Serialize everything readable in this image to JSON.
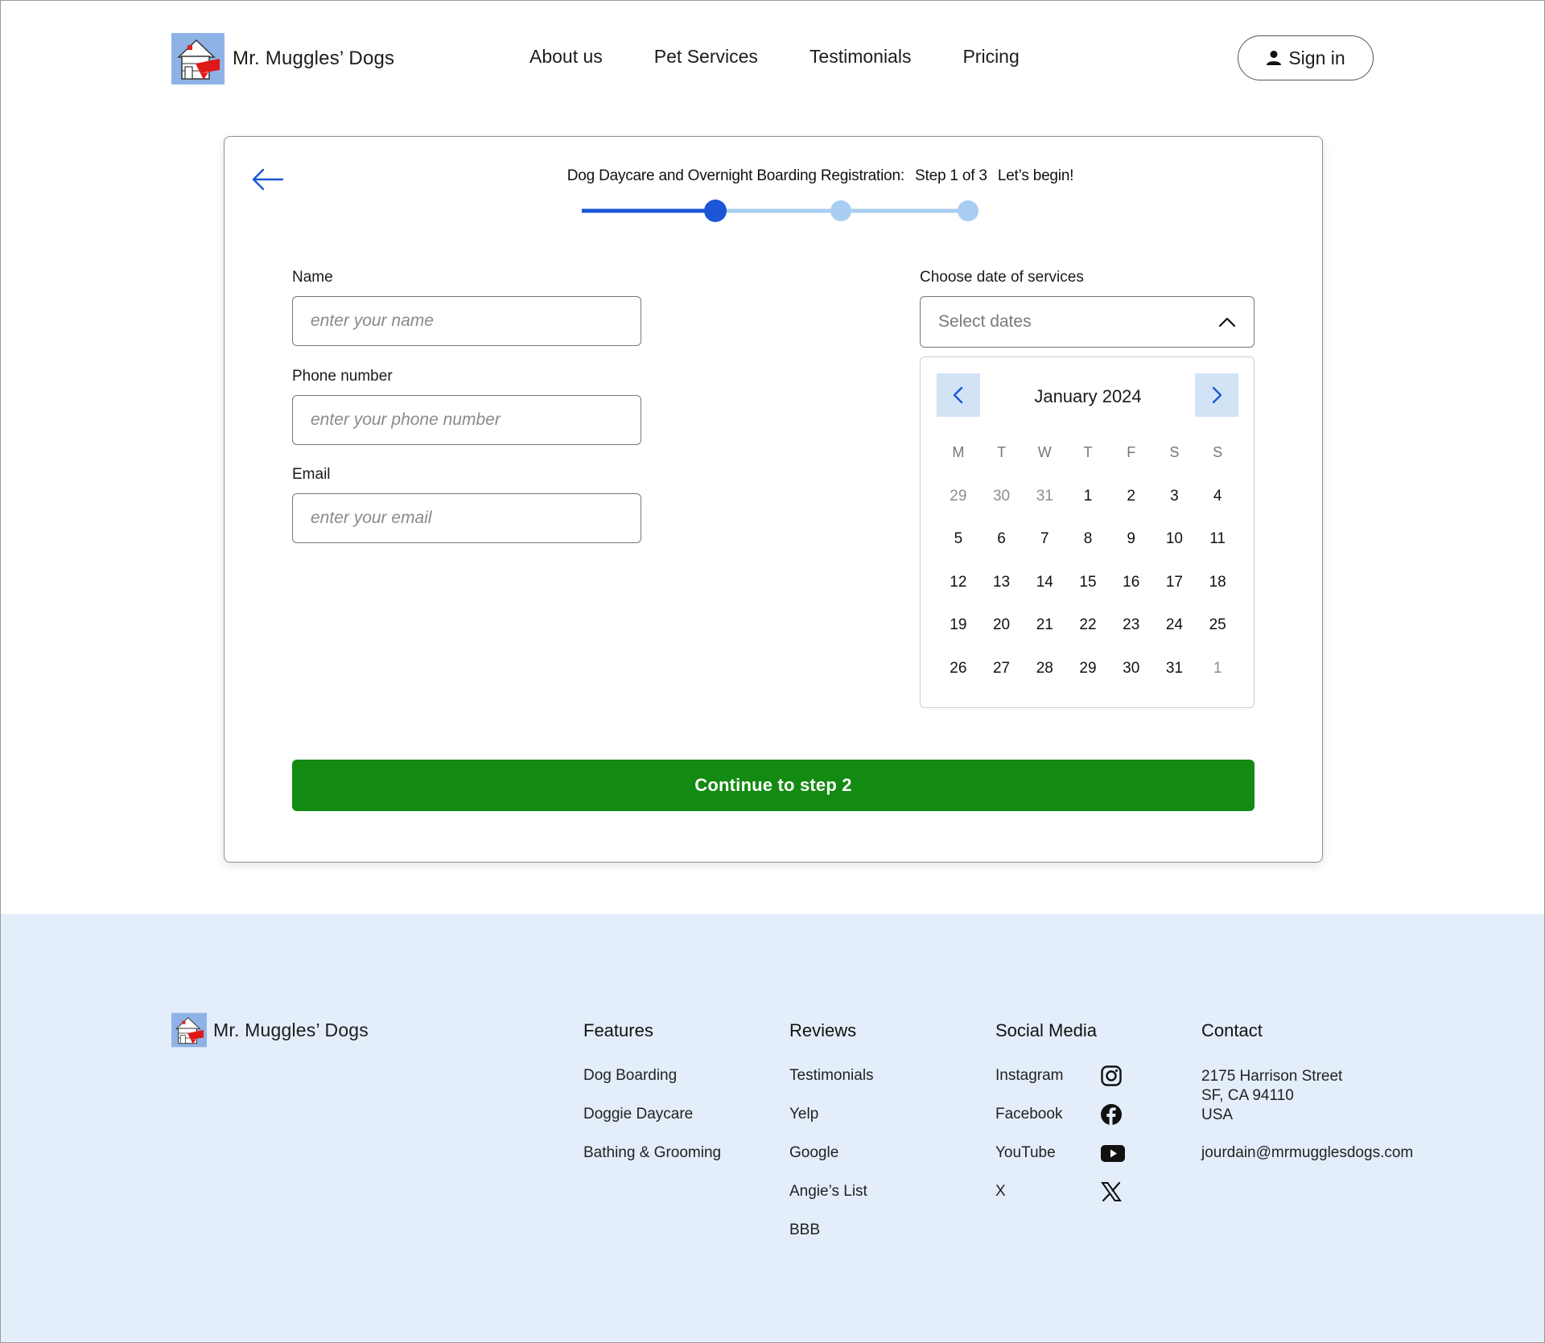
{
  "brand": {
    "name": "Mr. Muggles’ Dogs",
    "logo_icon": "doghouse-logo"
  },
  "nav": {
    "items": [
      {
        "label": "About us"
      },
      {
        "label": "Pet Services"
      },
      {
        "label": "Testimonials"
      },
      {
        "label": "Pricing"
      }
    ],
    "signin_label": "Sign in",
    "signin_icon": "user-icon"
  },
  "registration": {
    "title": "Dog Daycare and Overnight Boarding Registration:",
    "step_text": "Step 1 of 3",
    "tagline": "Let’s begin!",
    "current_step": 1,
    "total_steps": 3,
    "back_icon": "arrow-left-icon",
    "fields": {
      "name": {
        "label": "Name",
        "placeholder": "enter your name",
        "value": ""
      },
      "phone": {
        "label": "Phone number",
        "placeholder": "enter your phone number",
        "value": ""
      },
      "email": {
        "label": "Email",
        "placeholder": "enter your email",
        "value": ""
      }
    },
    "dates": {
      "label": "Choose date of services",
      "placeholder": "Select dates",
      "month_label": "January 2024",
      "weekdays": [
        "M",
        "T",
        "W",
        "T",
        "F",
        "S",
        "S"
      ],
      "weeks": [
        [
          {
            "d": "29",
            "muted": true
          },
          {
            "d": "30",
            "muted": true
          },
          {
            "d": "31",
            "muted": true
          },
          {
            "d": "1"
          },
          {
            "d": "2"
          },
          {
            "d": "3"
          },
          {
            "d": "4"
          }
        ],
        [
          {
            "d": "5"
          },
          {
            "d": "6"
          },
          {
            "d": "7"
          },
          {
            "d": "8"
          },
          {
            "d": "9"
          },
          {
            "d": "10"
          },
          {
            "d": "11"
          }
        ],
        [
          {
            "d": "12"
          },
          {
            "d": "13"
          },
          {
            "d": "14"
          },
          {
            "d": "15"
          },
          {
            "d": "16"
          },
          {
            "d": "17"
          },
          {
            "d": "18"
          }
        ],
        [
          {
            "d": "19"
          },
          {
            "d": "20"
          },
          {
            "d": "21"
          },
          {
            "d": "22"
          },
          {
            "d": "23"
          },
          {
            "d": "24"
          },
          {
            "d": "25"
          }
        ],
        [
          {
            "d": "26"
          },
          {
            "d": "27"
          },
          {
            "d": "28"
          },
          {
            "d": "29"
          },
          {
            "d": "30"
          },
          {
            "d": "31"
          },
          {
            "d": "1",
            "muted": true
          }
        ]
      ]
    },
    "continue_label": "Continue to step 2"
  },
  "footer": {
    "brand_name": "Mr. Muggles’ Dogs",
    "features": {
      "heading": "Features",
      "links": [
        "Dog Boarding",
        "Doggie Daycare",
        "Bathing & Grooming"
      ]
    },
    "reviews": {
      "heading": "Reviews",
      "links": [
        "Testimonials",
        "Yelp",
        "Google",
        "Angie’s List",
        "BBB"
      ]
    },
    "social": {
      "heading": "Social Media",
      "links": [
        {
          "label": "Instagram",
          "icon": "instagram-icon"
        },
        {
          "label": "Facebook",
          "icon": "facebook-icon"
        },
        {
          "label": "YouTube",
          "icon": "youtube-icon"
        },
        {
          "label": "X",
          "icon": "x-icon"
        }
      ]
    },
    "contact": {
      "heading": "Contact",
      "address": [
        "2175 Harrison Street",
        "SF, CA 94110",
        "USA"
      ],
      "email": "jourdain@mrmugglesdogs.com"
    }
  },
  "colors": {
    "primary_blue": "#1a56d6",
    "light_blue": "#a9cdf0",
    "calendar_nav_bg": "#d3e3f6",
    "continue_green": "#138a12",
    "footer_bg": "#e4eefa"
  }
}
